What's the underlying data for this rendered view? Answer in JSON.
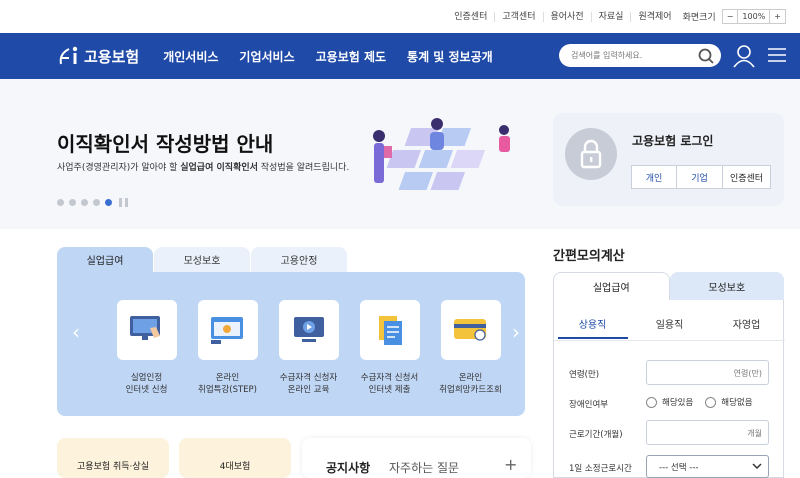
{
  "util": {
    "links": [
      "인증센터",
      "고객센터",
      "용어사전",
      "자료실",
      "원격제어"
    ],
    "zoom_label": "화면크기",
    "zoom_minus": "−",
    "zoom_value": "100%",
    "zoom_plus": "+"
  },
  "nav": {
    "logo_text": "고용보험",
    "menu": [
      "개인서비스",
      "기업서비스",
      "고용보험 제도",
      "통계 및 정보공개"
    ],
    "search_placeholder": "검색어를 입력하세요."
  },
  "hero": {
    "title": "이직확인서 작성방법 안내",
    "sub_prefix": "사업주(경영관리자)가 알아야 할 ",
    "sub_bold": "실업급여 이직확인서",
    "sub_suffix": " 작성법을 알려드립니다.",
    "slide_count": 5,
    "active_slide": 5
  },
  "login": {
    "title": "고용보험 로그인",
    "buttons": [
      "개인",
      "기업",
      "인증센터"
    ]
  },
  "service_tabs": [
    "실업급여",
    "모성보호",
    "고용안정"
  ],
  "services": [
    {
      "line1": "실업인정",
      "line2": "인터넷 신청",
      "icon": "monitor-touch-icon"
    },
    {
      "line1": "온라인",
      "line2": "취업특강(STEP)",
      "icon": "online-lecture-icon"
    },
    {
      "line1": "수급자격 신청자",
      "line2": "온라인 교육",
      "icon": "video-play-icon"
    },
    {
      "line1": "수급자격 신청서",
      "line2": "인터넷 제출",
      "icon": "document-icon"
    },
    {
      "line1": "온라인",
      "line2": "취업희망카드조회",
      "icon": "card-icon"
    }
  ],
  "bottom": {
    "box1": "고용보험 취득·상실",
    "box2": "4대보험",
    "notice_tab": "공지사항",
    "faq_tab": "자주하는 질문",
    "more": "+"
  },
  "calc": {
    "title": "간편모의계산",
    "tabs": [
      "실업급여",
      "모성보호"
    ],
    "types": [
      "상용직",
      "일용직",
      "자영업"
    ],
    "age_label": "연령(만)",
    "age_placeholder": "연령(만)",
    "disability_label": "장애인여부",
    "radio_yes": "해당있음",
    "radio_no": "해당없음",
    "period_label": "근로기간(개월)",
    "period_placeholder": "개월",
    "hours_label": "1일 소정근로시간",
    "hours_select": "--- 선택 ---"
  },
  "colors": {
    "nav": "#1f4aa8",
    "tab_active": "#bfd6f5",
    "accent": "#3a6fd2"
  }
}
